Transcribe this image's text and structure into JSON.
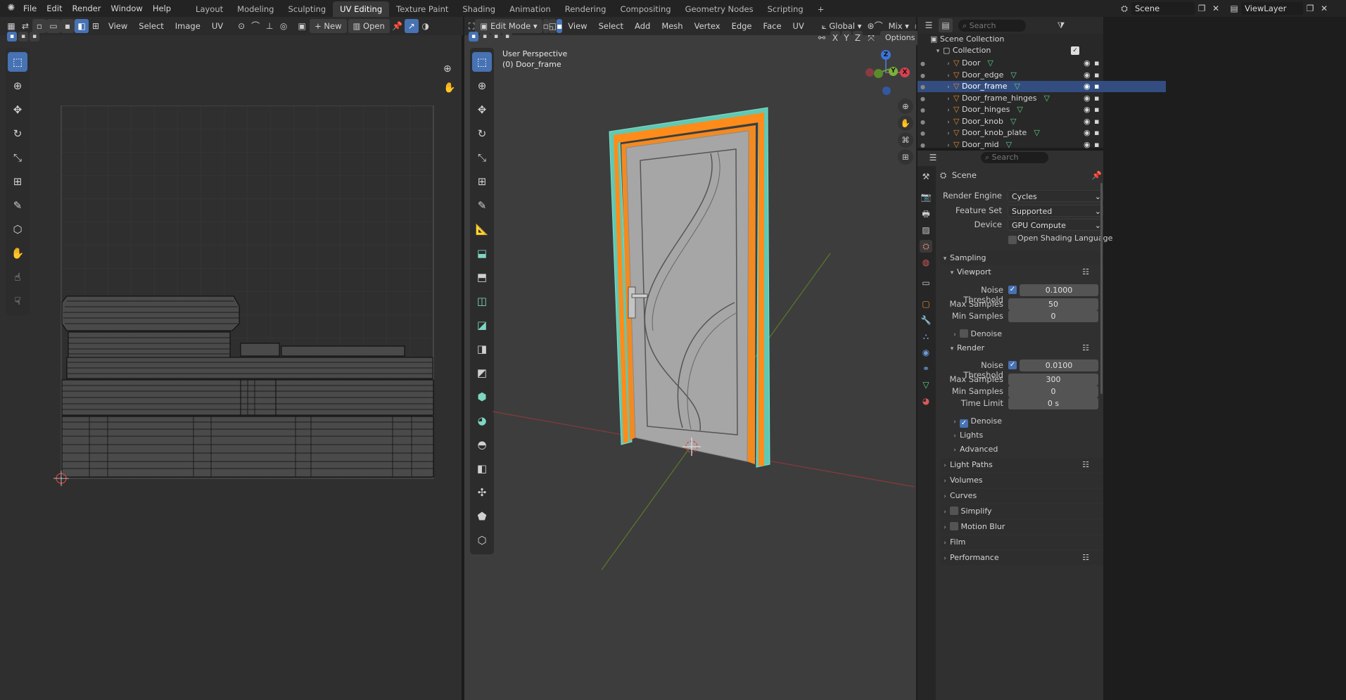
{
  "topbar": {
    "menus": [
      "File",
      "Edit",
      "Render",
      "Window",
      "Help"
    ],
    "workspaces": [
      "Layout",
      "Modeling",
      "Sculpting",
      "UV Editing",
      "Texture Paint",
      "Shading",
      "Animation",
      "Rendering",
      "Compositing",
      "Geometry Nodes",
      "Scripting"
    ],
    "add_tab": "+",
    "scene": "Scene",
    "view_layer": "ViewLayer"
  },
  "uv_editor": {
    "menus": [
      "View",
      "Select",
      "Image",
      "UV"
    ],
    "new_label": "New",
    "open_label": "Open"
  },
  "viewport": {
    "mode": "Edit Mode",
    "menus": [
      "View",
      "Select",
      "Add",
      "Mesh",
      "Vertex",
      "Edge",
      "Face",
      "UV"
    ],
    "transform": "Global",
    "pivot": "Mix",
    "options": "Options",
    "xyz": [
      "X",
      "Y",
      "Z"
    ],
    "overlay_title": "User Perspective",
    "overlay_object": "(0) Door_frame",
    "axes": {
      "x": "X",
      "y": "Y",
      "z": "Z"
    }
  },
  "outliner": {
    "search_placeholder": "Search",
    "scene_collection": "Scene Collection",
    "collection": "Collection",
    "items": [
      "Door",
      "Door_edge",
      "Door_frame",
      "Door_frame_hinges",
      "Door_hinges",
      "Door_knob",
      "Door_knob_plate",
      "Door_mid"
    ],
    "selected": "Door_frame"
  },
  "properties": {
    "search_placeholder": "Search",
    "context": "Scene",
    "render_engine_label": "Render Engine",
    "render_engine": "Cycles",
    "feature_set_label": "Feature Set",
    "feature_set": "Supported",
    "device_label": "Device",
    "device": "GPU Compute",
    "osl_label": "Open Shading Language",
    "sampling": "Sampling",
    "viewport": "Viewport",
    "noise_threshold_label": "Noise Threshold",
    "vp_noise": "0.1000",
    "max_samples_label": "Max Samples",
    "vp_max": "50",
    "min_samples_label": "Min Samples",
    "vp_min": "0",
    "denoise_label": "Denoise",
    "render": "Render",
    "r_noise": "0.0100",
    "r_max": "300",
    "r_min": "0",
    "time_limit_label": "Time Limit",
    "time_limit": "0 s",
    "lights": "Lights",
    "advanced": "Advanced",
    "panels": [
      "Light Paths",
      "Volumes",
      "Curves",
      "Simplify",
      "Motion Blur",
      "Film",
      "Performance"
    ]
  },
  "colors": {
    "accent": "#4772b3",
    "orange": "#ff8c1a",
    "teal": "#6fd6c2"
  }
}
